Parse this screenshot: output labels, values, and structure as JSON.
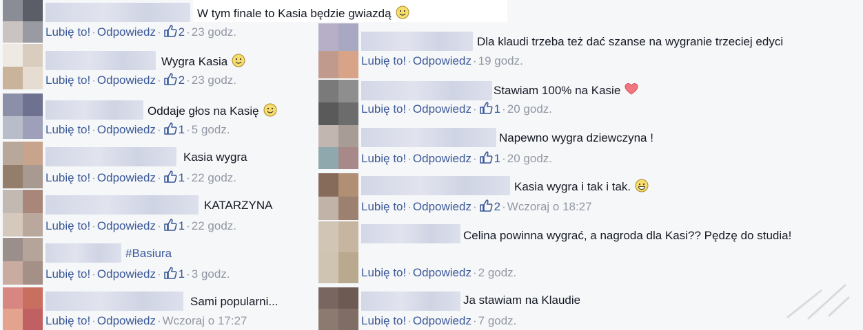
{
  "actions": {
    "like": "Lubię to!",
    "reply": "Odpowiedz",
    "separator": "·"
  },
  "colors": {
    "link": "#3b5998",
    "meta": "#9197a3",
    "text": "#141823",
    "background": "#f6f7f9"
  },
  "left_column": [
    {
      "text": "W tym finale to Kasia będzie gwiazdą",
      "emoji": "smile-emoji",
      "likes": "2",
      "time": "23 godz."
    },
    {
      "text": "Wygra Kasia",
      "emoji": "smile-emoji",
      "likes": "2",
      "time": "23 godz."
    },
    {
      "text": "Oddaje głos na Kasię",
      "emoji": "smile-emoji",
      "likes": "1",
      "time": "5 godz."
    },
    {
      "text": "Kasia wygra",
      "emoji": "",
      "likes": "1",
      "time": "22 godz."
    },
    {
      "text": "KATARZYNA",
      "emoji": "",
      "likes": "1",
      "time": "22 godz."
    },
    {
      "text": "#Basiura",
      "emoji": "",
      "likes": "1",
      "time": "3 godz."
    },
    {
      "text": "Sami popularni...",
      "emoji": "",
      "likes": "",
      "time": "Wczoraj o 17:27"
    }
  ],
  "right_column": [
    {
      "text": "Dla klaudi trzeba też dać szanse na wygranie trzeciej edyci",
      "emoji": "",
      "likes": "",
      "time": "19 godz."
    },
    {
      "text": "Stawiam 100% na Kasie",
      "emoji": "heart-emoji",
      "likes": "1",
      "time": "20 godz."
    },
    {
      "text": "Napewno wygra dziewczyna !",
      "emoji": "",
      "likes": "1",
      "time": "20 godz."
    },
    {
      "text": "Kasia wygra i tak i tak.",
      "emoji": "grin-emoji",
      "likes": "2",
      "time": "Wczoraj o 18:27"
    },
    {
      "text": "Celina powinna wygrać, a nagroda dla Kasi?? Pędzę do studia!",
      "emoji": "",
      "likes": "",
      "time": "2 godz."
    },
    {
      "text": "Ja stawiam na Klaudie",
      "emoji": "",
      "likes": "",
      "time": "7 godz."
    }
  ]
}
